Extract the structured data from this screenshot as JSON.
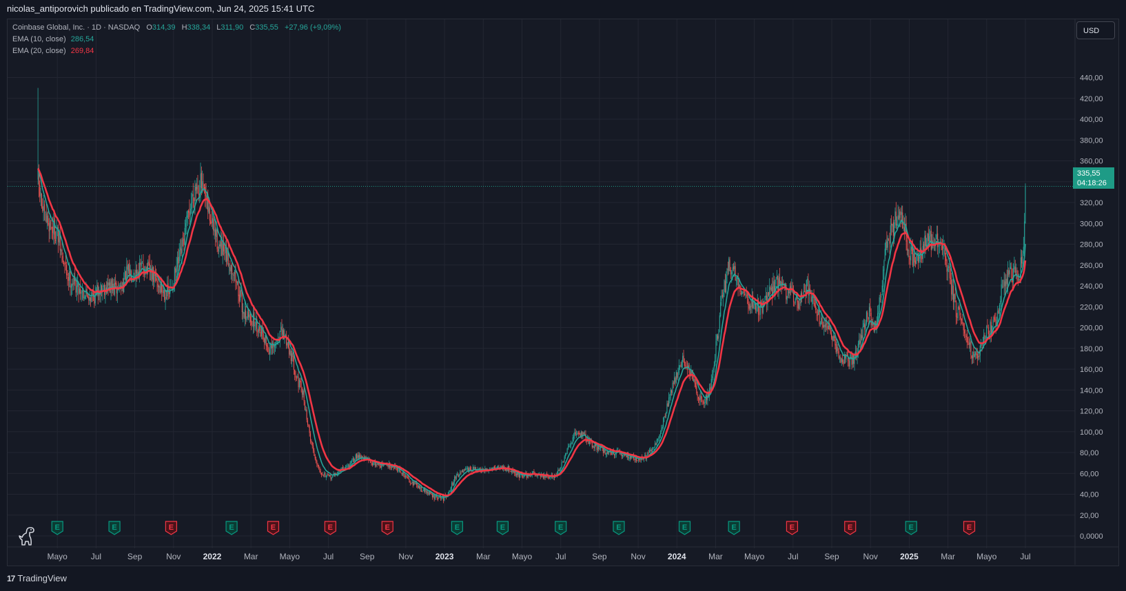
{
  "header": {
    "attribution": "nicolas_antiporovich publicado en TradingView.com, Jun 24, 2025 15:41 UTC"
  },
  "legend": {
    "symbol": "Coinbase Global, Inc. · 1D · NASDAQ",
    "o_label": "O",
    "o_value": "314,39",
    "h_label": "H",
    "h_value": "338,34",
    "l_label": "L",
    "l_value": "311,90",
    "c_label": "C",
    "c_value": "335,55",
    "change": "+27,96 (+9,09%)",
    "ema10_label": "EMA (10, close)",
    "ema10_value": "286,54",
    "ema20_label": "EMA (20, close)",
    "ema20_value": "269,84"
  },
  "currency_button": "USD",
  "price_tag": {
    "price": "335,55",
    "countdown": "04:18:26"
  },
  "footer": {
    "brand": "TradingView",
    "logo_glyph": "17"
  },
  "colors": {
    "up": "#26a69a",
    "down": "#ef5350",
    "ema10": "#26a69a",
    "ema20": "#f23645",
    "background": "#161a25",
    "grid": "#232632",
    "axis_text": "#b2b5be"
  },
  "events": [
    {
      "label": "E",
      "pos": 2.0,
      "status": "beat"
    },
    {
      "label": "E",
      "pos": 4.95,
      "status": "beat"
    },
    {
      "label": "E",
      "pos": 7.88,
      "status": "miss"
    },
    {
      "label": "E",
      "pos": 11.0,
      "status": "beat"
    },
    {
      "label": "E",
      "pos": 13.15,
      "status": "miss"
    },
    {
      "label": "E",
      "pos": 16.1,
      "status": "miss"
    },
    {
      "label": "E",
      "pos": 19.05,
      "status": "miss"
    },
    {
      "label": "E",
      "pos": 22.65,
      "status": "beat"
    },
    {
      "label": "E",
      "pos": 25.0,
      "status": "beat"
    },
    {
      "label": "E",
      "pos": 28.0,
      "status": "beat"
    },
    {
      "label": "E",
      "pos": 31.0,
      "status": "beat"
    },
    {
      "label": "E",
      "pos": 34.4,
      "status": "beat"
    },
    {
      "label": "E",
      "pos": 36.95,
      "status": "beat"
    },
    {
      "label": "E",
      "pos": 39.95,
      "status": "miss"
    },
    {
      "label": "E",
      "pos": 42.95,
      "status": "miss"
    },
    {
      "label": "E",
      "pos": 46.1,
      "status": "beat"
    },
    {
      "label": "E",
      "pos": 49.1,
      "status": "miss"
    }
  ],
  "chart_data": {
    "type": "candlestick",
    "symbol": "COIN",
    "interval": "1D",
    "x_unit": "months since 2021-03",
    "x_ticks": [
      {
        "label": "Mayo",
        "pos": 2,
        "bold": false
      },
      {
        "label": "Jul",
        "pos": 4,
        "bold": false
      },
      {
        "label": "Sep",
        "pos": 6,
        "bold": false
      },
      {
        "label": "Nov",
        "pos": 8,
        "bold": false
      },
      {
        "label": "2022",
        "pos": 10,
        "bold": true
      },
      {
        "label": "Mar",
        "pos": 12,
        "bold": false
      },
      {
        "label": "Mayo",
        "pos": 14,
        "bold": false
      },
      {
        "label": "Jul",
        "pos": 16,
        "bold": false
      },
      {
        "label": "Sep",
        "pos": 18,
        "bold": false
      },
      {
        "label": "Nov",
        "pos": 20,
        "bold": false
      },
      {
        "label": "2023",
        "pos": 22,
        "bold": true
      },
      {
        "label": "Mar",
        "pos": 24,
        "bold": false
      },
      {
        "label": "Mayo",
        "pos": 26,
        "bold": false
      },
      {
        "label": "Jul",
        "pos": 28,
        "bold": false
      },
      {
        "label": "Sep",
        "pos": 30,
        "bold": false
      },
      {
        "label": "Nov",
        "pos": 32,
        "bold": false
      },
      {
        "label": "2024",
        "pos": 34,
        "bold": true
      },
      {
        "label": "Mar",
        "pos": 36,
        "bold": false
      },
      {
        "label": "Mayo",
        "pos": 38,
        "bold": false
      },
      {
        "label": "Jul",
        "pos": 40,
        "bold": false
      },
      {
        "label": "Sep",
        "pos": 42,
        "bold": false
      },
      {
        "label": "Nov",
        "pos": 44,
        "bold": false
      },
      {
        "label": "2025",
        "pos": 46,
        "bold": true
      },
      {
        "label": "Mar",
        "pos": 48,
        "bold": false
      },
      {
        "label": "Mayo",
        "pos": 50,
        "bold": false
      },
      {
        "label": "Jul",
        "pos": 52,
        "bold": false
      }
    ],
    "xlim": [
      0,
      52
    ],
    "y_ticks": [
      "0,0000",
      "20,00",
      "40,00",
      "60,00",
      "80,00",
      "100,00",
      "120,00",
      "140,00",
      "160,00",
      "180,00",
      "200,00",
      "220,00",
      "240,00",
      "260,00",
      "280,00",
      "300,00",
      "320,00",
      "340,00",
      "360,00",
      "380,00",
      "400,00",
      "420,00",
      "440,00"
    ],
    "ylim": [
      0,
      460
    ],
    "last_price": 335.55,
    "price_path": [
      [
        1.0,
        342
      ],
      [
        1.1,
        328
      ],
      [
        1.3,
        305
      ],
      [
        1.6,
        300
      ],
      [
        2.0,
        290
      ],
      [
        2.3,
        262
      ],
      [
        2.6,
        248
      ],
      [
        3.0,
        240
      ],
      [
        3.5,
        232
      ],
      [
        3.9,
        230
      ],
      [
        4.2,
        238
      ],
      [
        4.6,
        240
      ],
      [
        5.0,
        236
      ],
      [
        5.3,
        240
      ],
      [
        5.6,
        252
      ],
      [
        6.0,
        254
      ],
      [
        6.5,
        258
      ],
      [
        6.9,
        250
      ],
      [
        7.4,
        236
      ],
      [
        7.8,
        232
      ],
      [
        8.0,
        245
      ],
      [
        8.4,
        272
      ],
      [
        8.8,
        310
      ],
      [
        9.1,
        336
      ],
      [
        9.4,
        338
      ],
      [
        9.7,
        318
      ],
      [
        10.0,
        298
      ],
      [
        10.4,
        275
      ],
      [
        10.8,
        265
      ],
      [
        11.1,
        255
      ],
      [
        11.3,
        240
      ],
      [
        11.6,
        215
      ],
      [
        11.9,
        210
      ],
      [
        12.2,
        205
      ],
      [
        12.6,
        196
      ],
      [
        12.9,
        178
      ],
      [
        13.2,
        180
      ],
      [
        13.5,
        195
      ],
      [
        13.8,
        190
      ],
      [
        14.1,
        172
      ],
      [
        14.4,
        150
      ],
      [
        14.7,
        135
      ],
      [
        15.0,
        100
      ],
      [
        15.3,
        75
      ],
      [
        15.6,
        62
      ],
      [
        16.0,
        56
      ],
      [
        16.3,
        58
      ],
      [
        16.7,
        64
      ],
      [
        17.1,
        68
      ],
      [
        17.5,
        78
      ],
      [
        17.9,
        74
      ],
      [
        18.3,
        70
      ],
      [
        18.7,
        68
      ],
      [
        19.1,
        68
      ],
      [
        19.5,
        66
      ],
      [
        19.9,
        58
      ],
      [
        20.3,
        52
      ],
      [
        20.7,
        46
      ],
      [
        21.1,
        42
      ],
      [
        21.5,
        37
      ],
      [
        22.0,
        36
      ],
      [
        22.3,
        46
      ],
      [
        22.6,
        58
      ],
      [
        23.0,
        62
      ],
      [
        23.5,
        64
      ],
      [
        24.0,
        62
      ],
      [
        24.5,
        66
      ],
      [
        25.0,
        66
      ],
      [
        25.4,
        64
      ],
      [
        25.8,
        58
      ],
      [
        26.2,
        58
      ],
      [
        26.6,
        60
      ],
      [
        27.0,
        58
      ],
      [
        27.4,
        56
      ],
      [
        27.7,
        58
      ],
      [
        28.0,
        66
      ],
      [
        28.4,
        84
      ],
      [
        28.8,
        100
      ],
      [
        29.2,
        96
      ],
      [
        29.6,
        88
      ],
      [
        30.0,
        84
      ],
      [
        30.4,
        80
      ],
      [
        30.8,
        80
      ],
      [
        31.2,
        78
      ],
      [
        31.6,
        76
      ],
      [
        32.0,
        74
      ],
      [
        32.4,
        76
      ],
      [
        32.8,
        84
      ],
      [
        33.1,
        96
      ],
      [
        33.4,
        118
      ],
      [
        33.7,
        140
      ],
      [
        34.0,
        155
      ],
      [
        34.3,
        170
      ],
      [
        34.6,
        160
      ],
      [
        34.8,
        150
      ],
      [
        35.1,
        135
      ],
      [
        35.4,
        128
      ],
      [
        35.7,
        140
      ],
      [
        36.0,
        178
      ],
      [
        36.3,
        225
      ],
      [
        36.7,
        260
      ],
      [
        37.1,
        248
      ],
      [
        37.4,
        235
      ],
      [
        37.7,
        225
      ],
      [
        38.0,
        222
      ],
      [
        38.3,
        218
      ],
      [
        38.6,
        225
      ],
      [
        39.0,
        240
      ],
      [
        39.3,
        245
      ],
      [
        39.6,
        235
      ],
      [
        40.0,
        230
      ],
      [
        40.3,
        225
      ],
      [
        40.7,
        240
      ],
      [
        41.0,
        230
      ],
      [
        41.4,
        208
      ],
      [
        41.8,
        198
      ],
      [
        42.1,
        185
      ],
      [
        42.4,
        172
      ],
      [
        42.8,
        168
      ],
      [
        43.2,
        170
      ],
      [
        43.6,
        196
      ],
      [
        43.9,
        215
      ],
      [
        44.2,
        198
      ],
      [
        44.5,
        225
      ],
      [
        44.8,
        280
      ],
      [
        45.1,
        295
      ],
      [
        45.4,
        308
      ],
      [
        45.7,
        300
      ],
      [
        46.0,
        272
      ],
      [
        46.3,
        262
      ],
      [
        46.6,
        272
      ],
      [
        46.9,
        282
      ],
      [
        47.2,
        285
      ],
      [
        47.5,
        282
      ],
      [
        47.8,
        272
      ],
      [
        48.1,
        245
      ],
      [
        48.4,
        218
      ],
      [
        48.7,
        205
      ],
      [
        49.0,
        192
      ],
      [
        49.3,
        172
      ],
      [
        49.6,
        175
      ],
      [
        49.9,
        192
      ],
      [
        50.2,
        200
      ],
      [
        50.5,
        206
      ],
      [
        50.8,
        238
      ],
      [
        51.1,
        248
      ],
      [
        51.4,
        252
      ],
      [
        51.7,
        250
      ],
      [
        51.85,
        270
      ],
      [
        51.95,
        300
      ],
      [
        52.0,
        335
      ]
    ],
    "series": [
      {
        "name": "EMA (10, close)",
        "smoothing": 10,
        "color": "#26a69a"
      },
      {
        "name": "EMA (20, close)",
        "smoothing": 20,
        "color": "#f23645"
      }
    ]
  }
}
